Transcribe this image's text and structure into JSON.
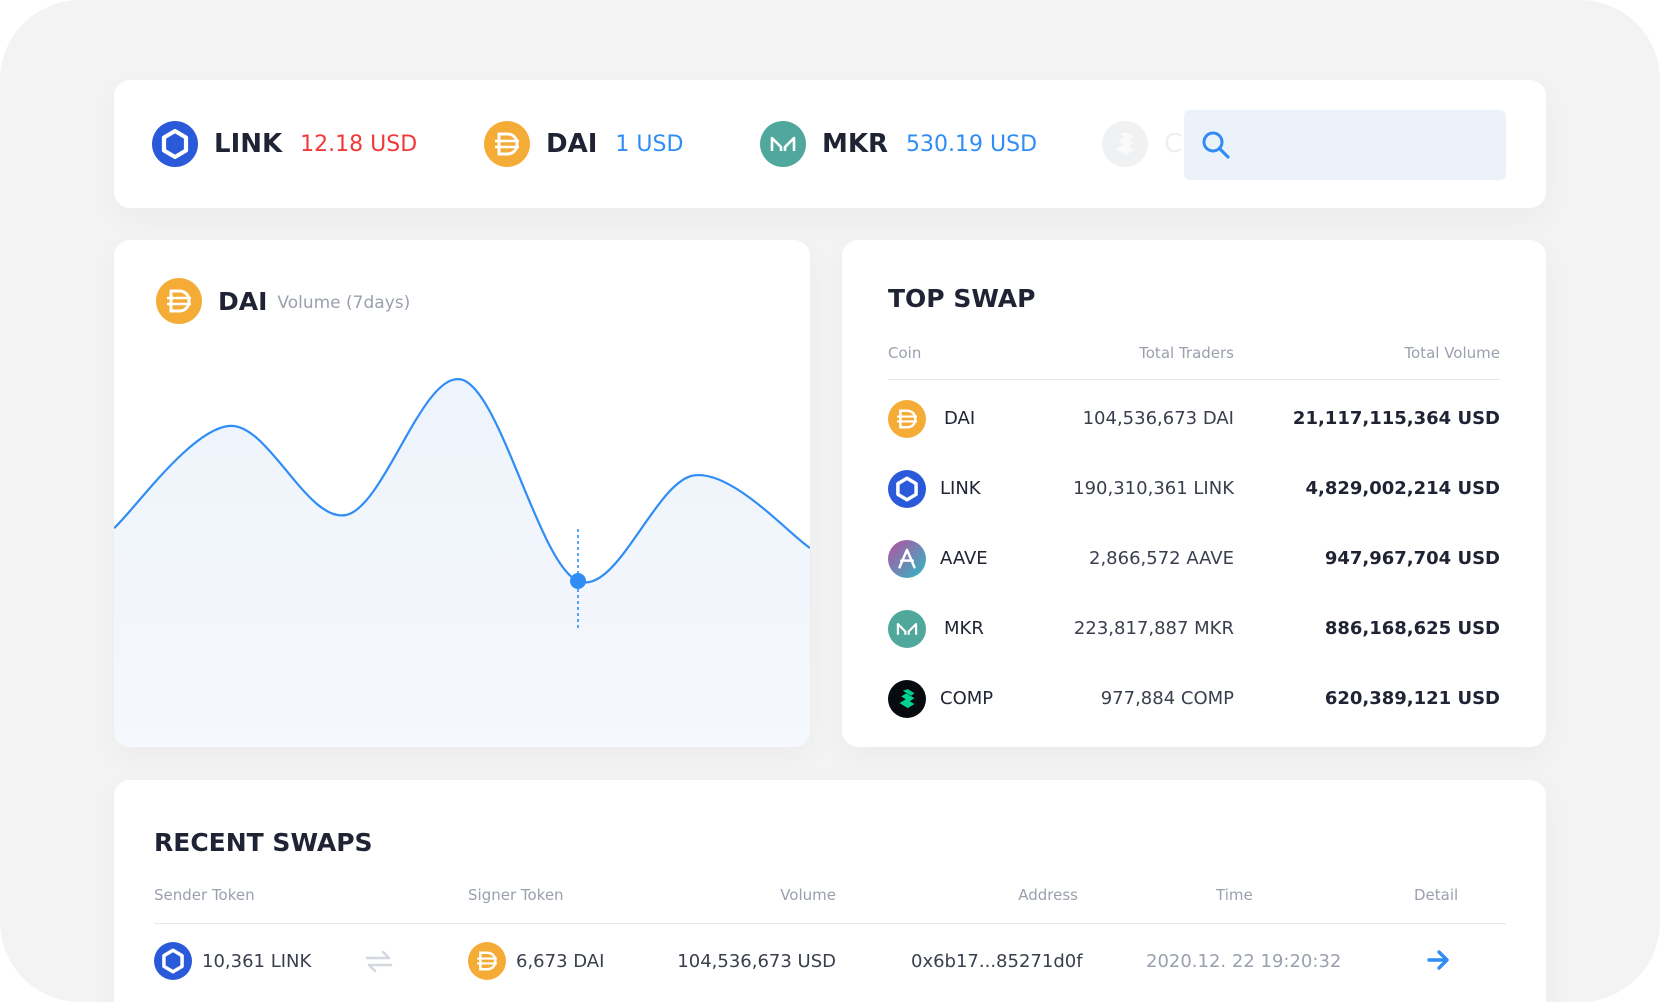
{
  "colors": {
    "link": "#2a5ada",
    "dai": "#f5ac37",
    "mkr": "#4fa89b",
    "aave_from": "#b6509e",
    "aave_to": "#2ebac6",
    "comp": "#00d395",
    "price_down": "#f03a3a",
    "price_up": "#2f8df5",
    "accent": "#2f8df5"
  },
  "ticker": [
    {
      "symbol": "LINK",
      "price": "12.18 USD",
      "icon": "link-icon",
      "trend": "down"
    },
    {
      "symbol": "DAI",
      "price": "1 USD",
      "icon": "dai-icon",
      "trend": "up"
    },
    {
      "symbol": "MKR",
      "price": "530.19 USD",
      "icon": "mkr-icon",
      "trend": "up"
    },
    {
      "symbol": "C",
      "price": "",
      "icon": "comp-icon",
      "trend": "faded"
    }
  ],
  "search": {
    "placeholder": "",
    "value": "",
    "icon": "search-icon"
  },
  "volume_chart": {
    "coin": "DAI",
    "subtitle": "Volume (7days)",
    "icon": "dai-icon",
    "line_color": "#2f8df5",
    "chart_data": {
      "type": "area",
      "title": "",
      "xlabel": "",
      "ylabel": "",
      "grid": false,
      "series": [
        {
          "values": [
            0.46,
            0.77,
            0.5,
            0.91,
            0.3,
            0.62,
            0.4
          ]
        }
      ],
      "highlighted_index": 4
    }
  },
  "top_swap": {
    "title": "TOP SWAP",
    "columns": [
      "Coin",
      "Total Traders",
      "Total Volume"
    ],
    "rows": [
      {
        "icon": "dai-icon",
        "coin": "DAI",
        "traders": "104,536,673 DAI",
        "volume": "21,117,115,364 USD"
      },
      {
        "icon": "link-icon",
        "coin": "LINK",
        "traders": "190,310,361 LINK",
        "volume": "4,829,002,214 USD"
      },
      {
        "icon": "aave-icon",
        "coin": "AAVE",
        "traders": "2,866,572 AAVE",
        "volume": "947,967,704 USD"
      },
      {
        "icon": "mkr-icon",
        "coin": "MKR",
        "traders": "223,817,887 MKR",
        "volume": "886,168,625 USD"
      },
      {
        "icon": "comp-icon",
        "coin": "COMP",
        "traders": "977,884 COMP",
        "volume": "620,389,121 USD"
      }
    ]
  },
  "recent_swaps": {
    "title": "RECENT SWAPS",
    "columns": [
      "Sender Token",
      "Signer Token",
      "Volume",
      "Address",
      "Time",
      "Detail"
    ],
    "rows": [
      {
        "sender": "10,361 LINK",
        "sender_icon": "link-icon",
        "swap_icon": "swap-arrows-icon",
        "signer": "6,673 DAI",
        "signer_icon": "dai-icon",
        "volume": "104,536,673 USD",
        "address": "0x6b17...85271d0f",
        "time": "2020.12. 22 19:20:32",
        "detail_icon": "arrow-right-icon"
      }
    ]
  }
}
